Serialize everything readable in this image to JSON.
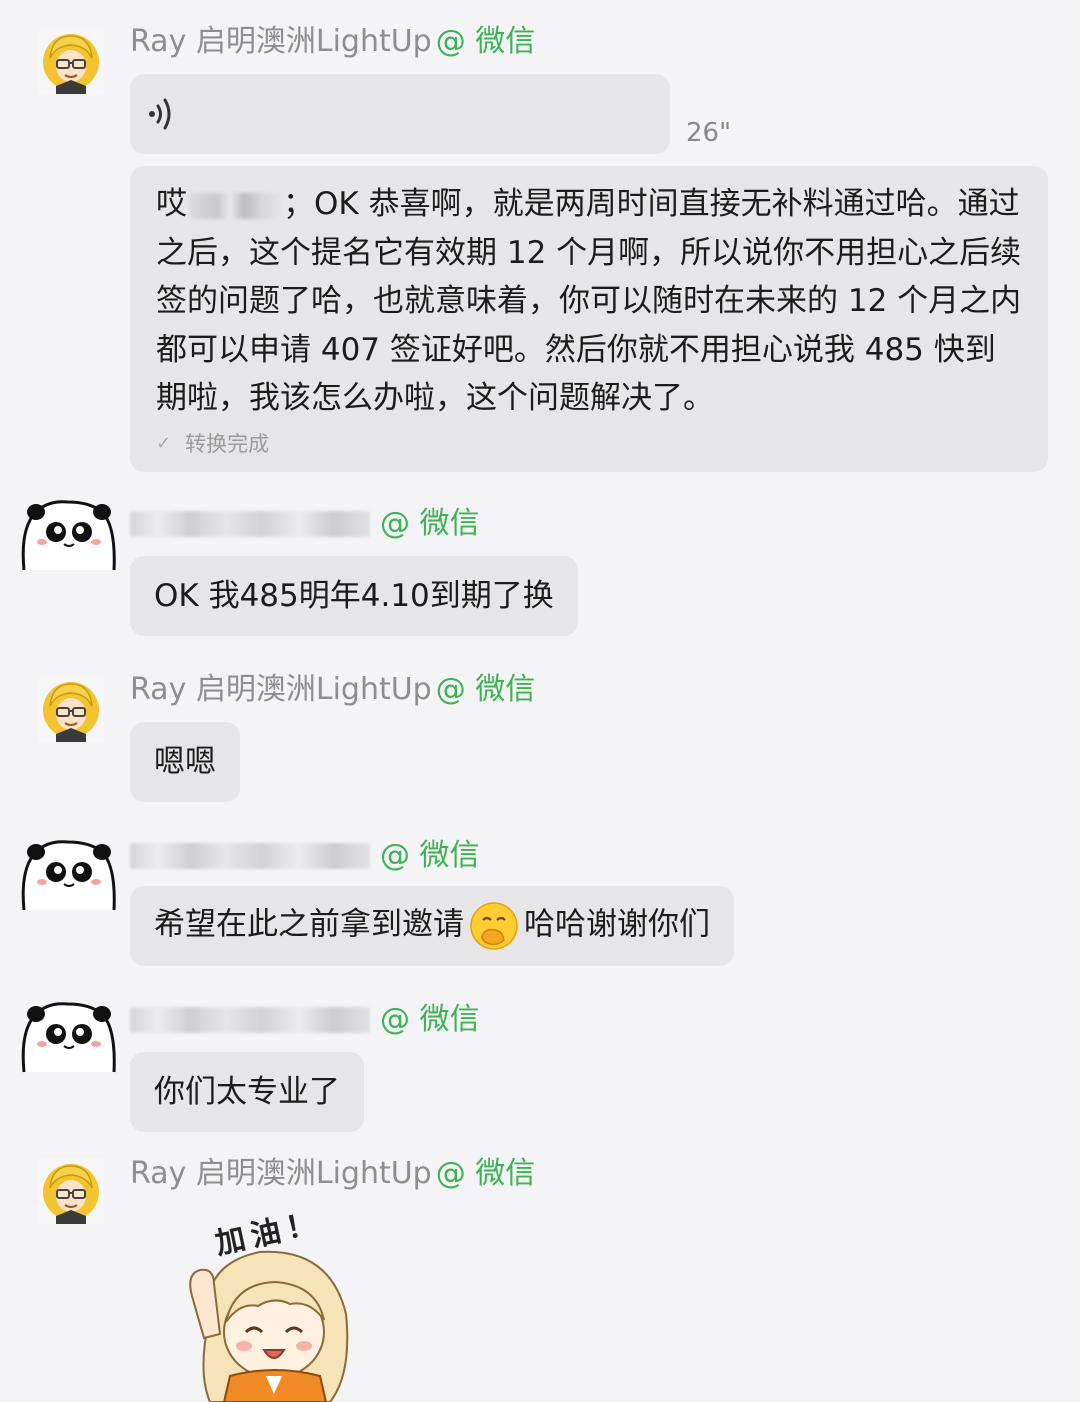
{
  "chat": {
    "messages": [
      {
        "sender_name": "Ray 启明澳洲LightUp",
        "sender_tag": "@ 微信",
        "voice": {
          "icon": "voice-wave-icon",
          "duration": "26\""
        },
        "transcript_part1": "哎",
        "transcript_part2": "；OK 恭喜啊，就是两周时间直接无补料通过哈。通过之后，这个提名它有效期 12 个月啊，所以说你不用担心之后续签的问题了哈，也就意味着，你可以随时在未来的 12 个月之内都可以申请 407 签证好吧。然后你就不用担心说我 485 快到期啦，我该怎么办啦，这个问题解决了。",
        "transcript_status": "转换完成"
      },
      {
        "sender_tag": "@ 微信",
        "text": "OK 我485明年4.10到期了换"
      },
      {
        "sender_name": "Ray 启明澳洲LightUp",
        "sender_tag": "@ 微信",
        "text": "嗯嗯"
      },
      {
        "sender_tag": "@ 微信",
        "text_before": "希望在此之前拿到邀请",
        "emoji": "face-with-hand-over-mouth-emoji",
        "text_after": "哈哈谢谢你们"
      },
      {
        "sender_tag": "@ 微信",
        "text": "你们太专业了"
      },
      {
        "sender_name": "Ray 启明澳洲LightUp",
        "sender_tag": "@ 微信",
        "sticker": {
          "name": "jiayou-sticker",
          "caption": "加油！"
        }
      }
    ]
  }
}
